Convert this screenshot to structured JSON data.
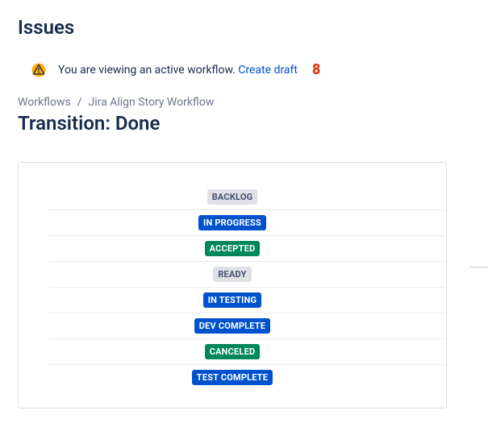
{
  "page_title": "Issues",
  "alert": {
    "text": "You are viewing an active workflow.",
    "link": "Create draft",
    "step": "8"
  },
  "breadcrumb": {
    "items": [
      "Workflows",
      "Jira Align Story Workflow"
    ],
    "sep": "/"
  },
  "transition_title": "Transition: Done",
  "statuses": [
    {
      "label": "BACKLOG",
      "color": "grey"
    },
    {
      "label": "IN PROGRESS",
      "color": "blue"
    },
    {
      "label": "ACCEPTED",
      "color": "green"
    },
    {
      "label": "READY",
      "color": "grey"
    },
    {
      "label": "IN TESTING",
      "color": "blue"
    },
    {
      "label": "DEV COMPLETE",
      "color": "blue"
    },
    {
      "label": "CANCELED",
      "color": "green"
    },
    {
      "label": "TEST COMPLETE",
      "color": "blue"
    }
  ],
  "colors": {
    "blue": "#0052CC",
    "green": "#00875A",
    "grey": "#DFE1E6",
    "warn": "#FFAB00",
    "link": "#0052CC",
    "danger": "#DE350B"
  }
}
